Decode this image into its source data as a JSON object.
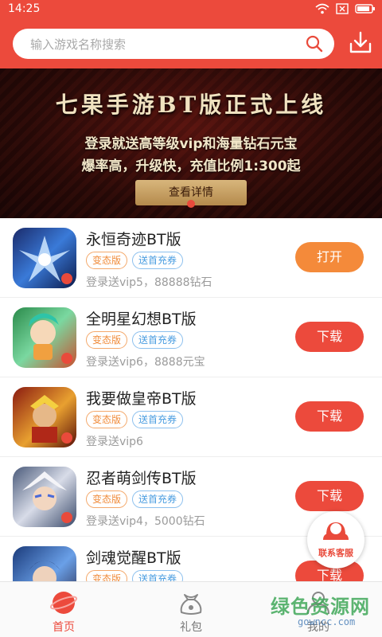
{
  "statusbar": {
    "time": "14:25"
  },
  "search": {
    "placeholder": "输入游戏名称搜索"
  },
  "banner": {
    "title": "七果手游BT版正式上线",
    "line1": "登录就送高等级vip和海量钻石元宝",
    "line2": "爆率高，升级快，充值比例1:300起",
    "button": "查看详情"
  },
  "games": [
    {
      "name": "永恒奇迹BT版",
      "tags": [
        "变态版",
        "送首充券"
      ],
      "desc": "登录送vip5，88888钻石",
      "action": "打开"
    },
    {
      "name": "全明星幻想BT版",
      "tags": [
        "变态版",
        "送首充券"
      ],
      "desc": "登录送vip6，8888元宝",
      "action": "下载"
    },
    {
      "name": "我要做皇帝BT版",
      "tags": [
        "变态版",
        "送首充券"
      ],
      "desc": "登录送vip6",
      "action": "下载"
    },
    {
      "name": "忍者萌剑传BT版",
      "tags": [
        "变态版",
        "送首充券"
      ],
      "desc": "登录送vip4，5000钻石",
      "action": "下载"
    },
    {
      "name": "剑魂觉醒BT版",
      "tags": [
        "变态版",
        "送首充券"
      ],
      "desc": "",
      "action": "下载"
    }
  ],
  "support": {
    "label": "联系客服"
  },
  "tabs": [
    {
      "label": "首页"
    },
    {
      "label": "礼包"
    },
    {
      "label": "我的"
    }
  ],
  "watermark": {
    "text": "绿色资源网",
    "url": "gowncc.com"
  },
  "colors": {
    "brand": "#ec4a3c",
    "open": "#f48a3a",
    "tag_orange": "#f08b3a",
    "tag_blue": "#4a9de0"
  }
}
